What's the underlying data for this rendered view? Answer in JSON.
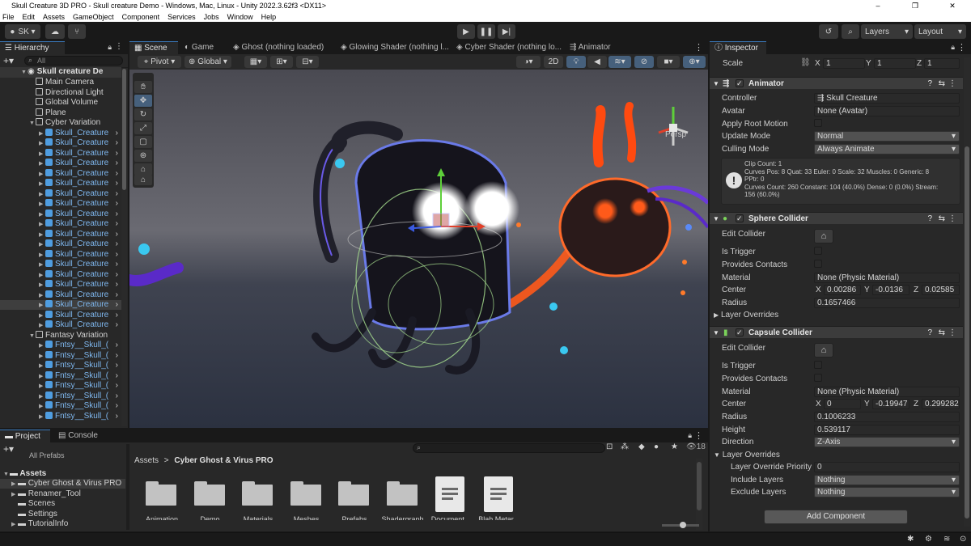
{
  "window": {
    "title": "Skull Creature 3D PRO - Skull creature Demo - Windows, Mac, Linux - Unity 2022.3.62f3 <DX11>",
    "controls": [
      "–",
      "❐",
      "✕"
    ]
  },
  "menu": [
    "File",
    "Edit",
    "Assets",
    "GameObject",
    "Component",
    "Services",
    "Jobs",
    "Window",
    "Help"
  ],
  "toolbar": {
    "account": "SK",
    "layers": "Layers",
    "layout": "Layout"
  },
  "hierarchy": {
    "tab": "Hierarchy",
    "search_placeholder": "All",
    "scene": "Skull creature De",
    "items": [
      {
        "label": "Main Camera",
        "depth": 1,
        "kind": "go"
      },
      {
        "label": "Directional Light",
        "depth": 1,
        "kind": "go"
      },
      {
        "label": "Global Volume",
        "depth": 1,
        "kind": "go"
      },
      {
        "label": "Plane",
        "depth": 1,
        "kind": "go"
      },
      {
        "label": "Cyber Variation",
        "depth": 1,
        "kind": "go",
        "expanded": true
      },
      {
        "label": "Skull_Creature",
        "depth": 2,
        "kind": "prefab"
      },
      {
        "label": "Skull_Creature",
        "depth": 2,
        "kind": "prefab"
      },
      {
        "label": "Skull_Creature",
        "depth": 2,
        "kind": "prefab"
      },
      {
        "label": "Skull_Creature",
        "depth": 2,
        "kind": "prefab"
      },
      {
        "label": "Skull_Creature",
        "depth": 2,
        "kind": "prefab"
      },
      {
        "label": "Skull_Creature",
        "depth": 2,
        "kind": "prefab"
      },
      {
        "label": "Skull_Creature",
        "depth": 2,
        "kind": "prefab"
      },
      {
        "label": "Skull_Creature",
        "depth": 2,
        "kind": "prefab"
      },
      {
        "label": "Skull_Creature",
        "depth": 2,
        "kind": "prefab"
      },
      {
        "label": "Skull_Creature",
        "depth": 2,
        "kind": "prefab"
      },
      {
        "label": "Skull_Creature",
        "depth": 2,
        "kind": "prefab"
      },
      {
        "label": "Skull_Creature",
        "depth": 2,
        "kind": "prefab"
      },
      {
        "label": "Skull_Creature",
        "depth": 2,
        "kind": "prefab"
      },
      {
        "label": "Skull_Creature",
        "depth": 2,
        "kind": "prefab"
      },
      {
        "label": "Skull_Creature",
        "depth": 2,
        "kind": "prefab"
      },
      {
        "label": "Skull_Creature",
        "depth": 2,
        "kind": "prefab"
      },
      {
        "label": "Skull_Creature",
        "depth": 2,
        "kind": "prefab"
      },
      {
        "label": "Skull_Creature",
        "depth": 2,
        "kind": "prefab",
        "selected": true
      },
      {
        "label": "Skull_Creature",
        "depth": 2,
        "kind": "prefab"
      },
      {
        "label": "Skull_Creature",
        "depth": 2,
        "kind": "prefab"
      },
      {
        "label": "Fantasy Variation",
        "depth": 1,
        "kind": "go",
        "expanded": true
      },
      {
        "label": "Fntsy__Skull_(",
        "depth": 2,
        "kind": "prefab"
      },
      {
        "label": "Fntsy__Skull_(",
        "depth": 2,
        "kind": "prefab"
      },
      {
        "label": "Fntsy__Skull_(",
        "depth": 2,
        "kind": "prefab"
      },
      {
        "label": "Fntsy__Skull_(",
        "depth": 2,
        "kind": "prefab"
      },
      {
        "label": "Fntsy__Skull_(",
        "depth": 2,
        "kind": "prefab"
      },
      {
        "label": "Fntsy__Skull_(",
        "depth": 2,
        "kind": "prefab"
      },
      {
        "label": "Fntsy__Skull_(",
        "depth": 2,
        "kind": "prefab"
      },
      {
        "label": "Fntsy__Skull_(",
        "depth": 2,
        "kind": "prefab"
      }
    ]
  },
  "scene_tabs": [
    "Scene",
    "Game",
    "Ghost (nothing loaded)",
    "Glowing Shader (nothing l...",
    "Cyber Shader (nothing lo...",
    "Animator"
  ],
  "scene_toolbar": {
    "pivot": "Pivot",
    "global": "Global",
    "mode2d": "2D",
    "persp": "Persp"
  },
  "inspector": {
    "tab": "Inspector",
    "scale": {
      "label": "Scale",
      "x": "1",
      "y": "1",
      "z": "1"
    },
    "animator": {
      "title": "Animator",
      "controller_label": "Controller",
      "controller": "Skull Creature",
      "avatar_label": "Avatar",
      "avatar": "None (Avatar)",
      "apply_root_motion": "Apply Root Motion",
      "update_mode_label": "Update Mode",
      "update_mode": "Normal",
      "culling_mode_label": "Culling Mode",
      "culling_mode": "Always Animate",
      "info": [
        "Clip Count: 1",
        "Curves Pos: 8 Quat: 33 Euler: 0 Scale: 32 Muscles: 0 Generic: 8",
        "PPtr: 0",
        "Curves Count: 260 Constant: 104 (40.0%) Dense: 0 (0.0%) Stream:",
        "156 (60.0%)"
      ]
    },
    "sphere": {
      "title": "Sphere Collider",
      "edit_collider": "Edit Collider",
      "is_trigger": "Is Trigger",
      "provides_contacts": "Provides Contacts",
      "material_label": "Material",
      "material": "None (Physic Material)",
      "center_label": "Center",
      "cx": "0.00286",
      "cy": "-0.0136",
      "cz": "0.02585",
      "radius_label": "Radius",
      "radius": "0.1657466",
      "layer_overrides": "Layer Overrides"
    },
    "capsule": {
      "title": "Capsule Collider",
      "edit_collider": "Edit Collider",
      "is_trigger": "Is Trigger",
      "provides_contacts": "Provides Contacts",
      "material_label": "Material",
      "material": "None (Physic Material)",
      "center_label": "Center",
      "cx": "0",
      "cy": "-0.19947",
      "cz": "0.299282",
      "radius_label": "Radius",
      "radius": "0.1006233",
      "height_label": "Height",
      "height": "0.539117",
      "direction_label": "Direction",
      "direction": "Z-Axis",
      "layer_overrides": "Layer Overrides",
      "priority_label": "Layer Override Priority",
      "priority": "0",
      "include_label": "Include Layers",
      "include": "Nothing",
      "exclude_label": "Exclude Layers",
      "exclude": "Nothing"
    },
    "add_component": "Add Component"
  },
  "project": {
    "tabs": [
      "Project",
      "Console"
    ],
    "favorites_item": "All Prefabs",
    "assets_root": "Assets",
    "tree": [
      "Cyber Ghost & Virus PRO",
      "Renamer_Tool",
      "Scenes",
      "Settings",
      "TutorialInfo"
    ],
    "breadcrumb_root": "Assets",
    "breadcrumb_current": "Cyber Ghost & Virus PRO",
    "count": "18",
    "grid": [
      {
        "label": "Animation",
        "kind": "folder"
      },
      {
        "label": "Demo",
        "kind": "folder"
      },
      {
        "label": "Materials",
        "kind": "folder"
      },
      {
        "label": "Meshes",
        "kind": "folder"
      },
      {
        "label": "Prefabs",
        "kind": "folder"
      },
      {
        "label": "Shadergraph",
        "kind": "folder"
      },
      {
        "label": "Document...",
        "kind": "doc"
      },
      {
        "label": "Blah Metar...",
        "kind": "doc"
      }
    ]
  }
}
